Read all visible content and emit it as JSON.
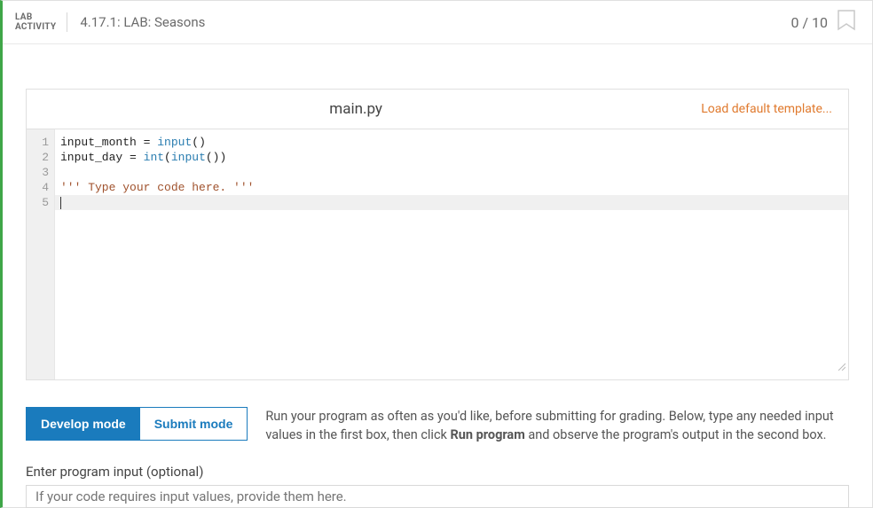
{
  "header": {
    "badge_line1": "LAB",
    "badge_line2": "ACTIVITY",
    "title": "4.17.1: LAB: Seasons",
    "score": "0 / 10"
  },
  "editor": {
    "filename": "main.py",
    "load_template": "Load default template...",
    "gutter": [
      "1",
      "2",
      "3",
      "4",
      "5"
    ],
    "lines": {
      "l1_a": "input_month ",
      "l1_b": "=",
      "l1_c": " ",
      "l1_d": "input",
      "l1_e": "()",
      "l2_a": "input_day ",
      "l2_b": "=",
      "l2_c": " ",
      "l2_d": "int",
      "l2_e": "(",
      "l2_f": "input",
      "l2_g": "())",
      "l4": "''' Type your code here. '''"
    }
  },
  "modes": {
    "develop": "Develop mode",
    "submit": "Submit mode",
    "desc_a": "Run your program as often as you'd like, before submitting for grading. Below, type any needed input values in the first box, then click ",
    "desc_b": "Run program",
    "desc_c": " and observe the program's output in the second box."
  },
  "input": {
    "label": "Enter program input (optional)",
    "placeholder": "If your code requires input values, provide them here."
  }
}
